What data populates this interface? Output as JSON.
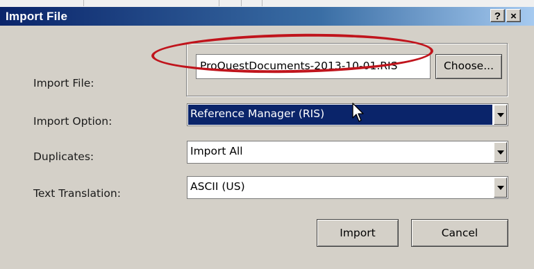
{
  "dialog": {
    "title": "Import File",
    "help_button": "?",
    "close_button": "×"
  },
  "fields": {
    "import_file": {
      "label": "Import File:",
      "value": "ProQuestDocuments-2013-10-01.RIS",
      "choose_button": "Choose..."
    },
    "import_option": {
      "label": "Import Option:",
      "value": "Reference Manager (RIS)"
    },
    "duplicates": {
      "label": "Duplicates:",
      "value": "Import All"
    },
    "text_translation": {
      "label": "Text Translation:",
      "value": "ASCII (US)"
    }
  },
  "buttons": {
    "import": "Import",
    "cancel": "Cancel"
  },
  "annotation": {
    "highlight_color": "#c0141c"
  },
  "colors": {
    "titlebar_start": "#0a246a",
    "titlebar_end": "#a6caf0",
    "dialog_bg": "#d4d0c8",
    "selection": "#0a246a"
  }
}
